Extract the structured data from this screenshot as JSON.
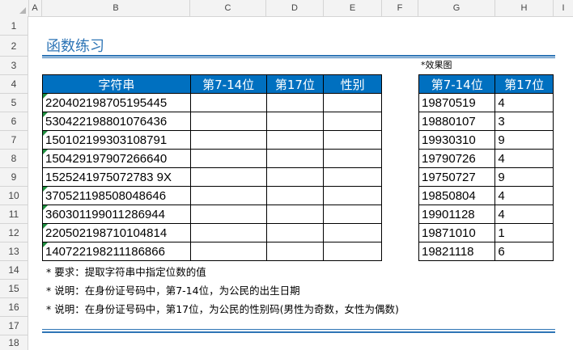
{
  "columns": [
    "A",
    "B",
    "C",
    "D",
    "E",
    "F",
    "G",
    "H",
    "I"
  ],
  "rows": [
    "1",
    "2",
    "3",
    "4",
    "5",
    "6",
    "7",
    "8",
    "9",
    "10",
    "11",
    "12",
    "13",
    "14",
    "15",
    "16",
    "17",
    "18"
  ],
  "title": "函数练习",
  "effect_label": "*效果图",
  "main_table": {
    "headers": [
      "字符串",
      "第7-14位",
      "第17位",
      "性别"
    ],
    "values": [
      "220402198705195445",
      "530422198801076436",
      "150102199303108791",
      "150429197907266640",
      "1525241975072783 9X",
      "370521198508048646",
      "360301199011286944",
      "220502198710104814",
      "140722198211186866"
    ]
  },
  "effect_table": {
    "headers": [
      "第7-14位",
      "第17位"
    ],
    "rows": [
      [
        "19870519",
        "4"
      ],
      [
        "19880107",
        "3"
      ],
      [
        "19930310",
        "9"
      ],
      [
        "19790726",
        "4"
      ],
      [
        "19750727",
        "9"
      ],
      [
        "19850804",
        "4"
      ],
      [
        "19901128",
        "4"
      ],
      [
        "19871010",
        "1"
      ],
      [
        "19821118",
        "6"
      ]
    ]
  },
  "notes": [
    "* 要求：提取字符串中指定位数的值",
    "* 说明：在身份证号码中，第7-14位，为公民的出生日期",
    "* 说明：在身份证号码中，第17位，为公民的性别码(男性为奇数，女性为偶数)"
  ]
}
